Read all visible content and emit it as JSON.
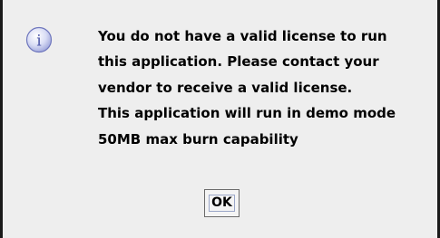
{
  "dialog": {
    "icon": "info-icon",
    "icon_glyph": "i",
    "accent_color": "#8e96d6",
    "message_lines": [
      "You do not have a valid license to run",
      "this application. Please contact your",
      "vendor to receive a valid license.",
      "This application will run in demo mode",
      "50MB max burn capability"
    ],
    "ok_label": "OK"
  }
}
